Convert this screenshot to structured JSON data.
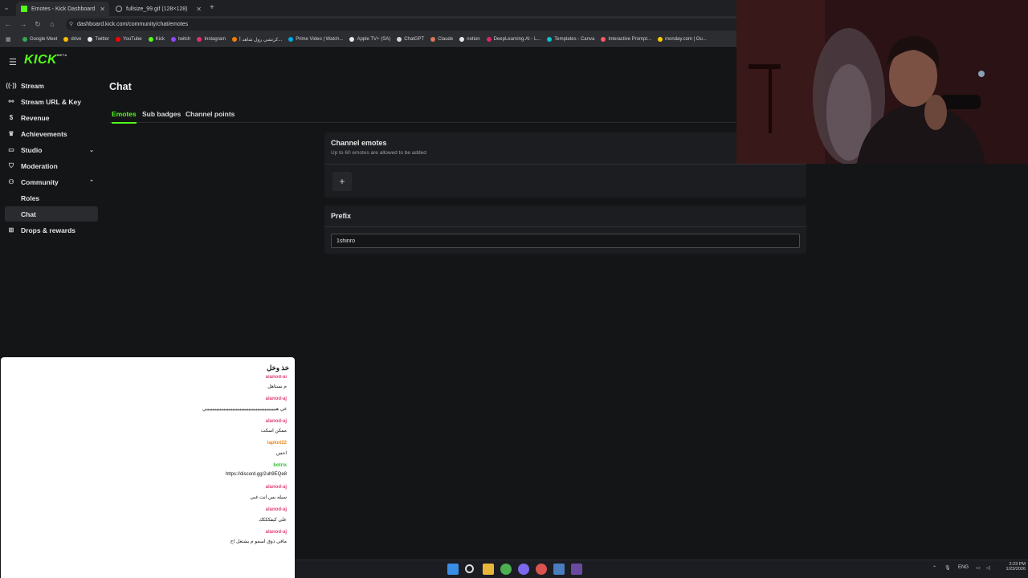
{
  "browser": {
    "tabs": [
      {
        "title": "Emotes - Kick Dashboard",
        "active": true,
        "icon": "kick-icon"
      },
      {
        "title": "fullsize_99.gif (128×128)",
        "active": false,
        "icon": "globe-icon"
      }
    ],
    "new_tab": "+",
    "url": "dashboard.kick.com/community/chat/emotes",
    "bookmarks": [
      {
        "label": "Google Meet",
        "color": "#34a853"
      },
      {
        "label": "drive",
        "color": "#fbbc04"
      },
      {
        "label": "Twitter",
        "color": "#e8e8e8"
      },
      {
        "label": "YouTube",
        "color": "#ff0000"
      },
      {
        "label": "Kick",
        "color": "#53fc18"
      },
      {
        "label": "twitch",
        "color": "#9146ff"
      },
      {
        "label": "Instagram",
        "color": "#e1306c"
      },
      {
        "label": "كرتشي رول شاهد أ...",
        "color": "#f57c00"
      },
      {
        "label": "Prime Video | Watch...",
        "color": "#00a8e1"
      },
      {
        "label": "Apple TV+ (SA)",
        "color": "#e8e8e8"
      },
      {
        "label": "ChatGPT",
        "color": "#d4d4d4"
      },
      {
        "label": "Claude",
        "color": "#d97757"
      },
      {
        "label": "notion",
        "color": "#e8e8e8"
      },
      {
        "label": "DeepLearning.AI - L...",
        "color": "#e0245e"
      },
      {
        "label": "Templates - Canva",
        "color": "#00c4cc"
      },
      {
        "label": "Interactive Prompt...",
        "color": "#ff5a5f"
      },
      {
        "label": "monday.com | Ou...",
        "color": "#ffcb00"
      }
    ]
  },
  "logo": {
    "text": "KICK",
    "tag": "BETA"
  },
  "sidebar": {
    "items": [
      {
        "label": "Stream",
        "icon": "broadcast-icon"
      },
      {
        "label": "Stream URL & Key",
        "icon": "link-icon"
      },
      {
        "label": "Revenue",
        "icon": "dollar-icon"
      },
      {
        "label": "Achievements",
        "icon": "trophy-icon"
      },
      {
        "label": "Studio",
        "icon": "studio-icon"
      },
      {
        "label": "Moderation",
        "icon": "shield-icon"
      },
      {
        "label": "Community",
        "icon": "community-icon"
      },
      {
        "label": "Roles"
      },
      {
        "label": "Chat"
      },
      {
        "label": "Drops & rewards",
        "icon": "gift-icon"
      }
    ]
  },
  "page": {
    "title": "Chat",
    "tabs": [
      "Emotes",
      "Sub badges",
      "Channel points"
    ]
  },
  "emotes_panel": {
    "title": "Channel emotes",
    "subtitle": "Up to 60 emotes are allowed to be added",
    "add_label": "+"
  },
  "prefix_panel": {
    "title": "Prefix",
    "value": "1shinro"
  },
  "chat_overlay": {
    "title": "خذ وخل",
    "top_user": "alanod-aj",
    "messages": [
      {
        "user": "",
        "text": "م نستاهل"
      },
      {
        "user": "alanod-aj",
        "user_color": "#e0457b",
        "text": "غي هييييييييييييييييييييييييييييييييييييييييييييييييي"
      },
      {
        "user": "alanod-aj",
        "user_color": "#e0457b",
        "text": "ممكن اسكت"
      },
      {
        "user": "lapkot22",
        "user_color": "#e58a1f",
        "text": "احس"
      },
      {
        "user": "botrix",
        "user_color": "#2fbf2f",
        "text": "https://discord.gg/2uh9EQe8"
      },
      {
        "user": "alanod-aj",
        "user_color": "#e0457b",
        "text": "سيله بس انت غبي"
      },
      {
        "user": "alanod-aj",
        "user_color": "#e0457b",
        "text": "على كيفكككك"
      },
      {
        "user": "alanod-aj",
        "user_color": "#e0457b",
        "text": "مافي ذوق اسمو م يشتغل اح"
      }
    ]
  },
  "taskbar": {
    "lang": "ENG",
    "time": "2:23 PM",
    "date": "1/23/2026"
  },
  "colors": {
    "accent": "#53fc18",
    "background": "#141517",
    "panel": "#1c1d20"
  }
}
